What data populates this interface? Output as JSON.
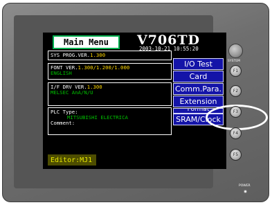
{
  "screen": {
    "main_menu_label": "Main Menu",
    "model": "V706TD",
    "datetime": "2003-10-21 10:55:20",
    "sys_prog": {
      "label": "SYS PROG.VER.",
      "value": "1.300"
    },
    "font": {
      "label": "FONT VER.",
      "value": "1.300/1.200/1.000",
      "language": "ENGLISH"
    },
    "if_drv": {
      "label": "I/F DRV VER.",
      "value": "1.300",
      "plc_name": "MELSEC AnA/N/U"
    },
    "plc": {
      "type_label": "PLC Type:",
      "type_value": "MITSUBISHI ELECTRICA",
      "comment_label": "Comment:"
    },
    "menu_buttons": [
      "I/O Test",
      "Card",
      "Comm.Para.",
      "Extension",
      "Format",
      "SRAM/Clock"
    ],
    "editor_label": "Editor:MJ1"
  },
  "panel": {
    "system_label": "SYSTEM",
    "function_keys": [
      "F1",
      "F2",
      "F3",
      "F4",
      "F5"
    ],
    "power_label": "POWER"
  },
  "colors": {
    "screen_bg": "#000000",
    "button_bg": "#1414a8",
    "value_yellow": "#ffd700",
    "value_green": "#00c000",
    "bezel": "#707070"
  }
}
